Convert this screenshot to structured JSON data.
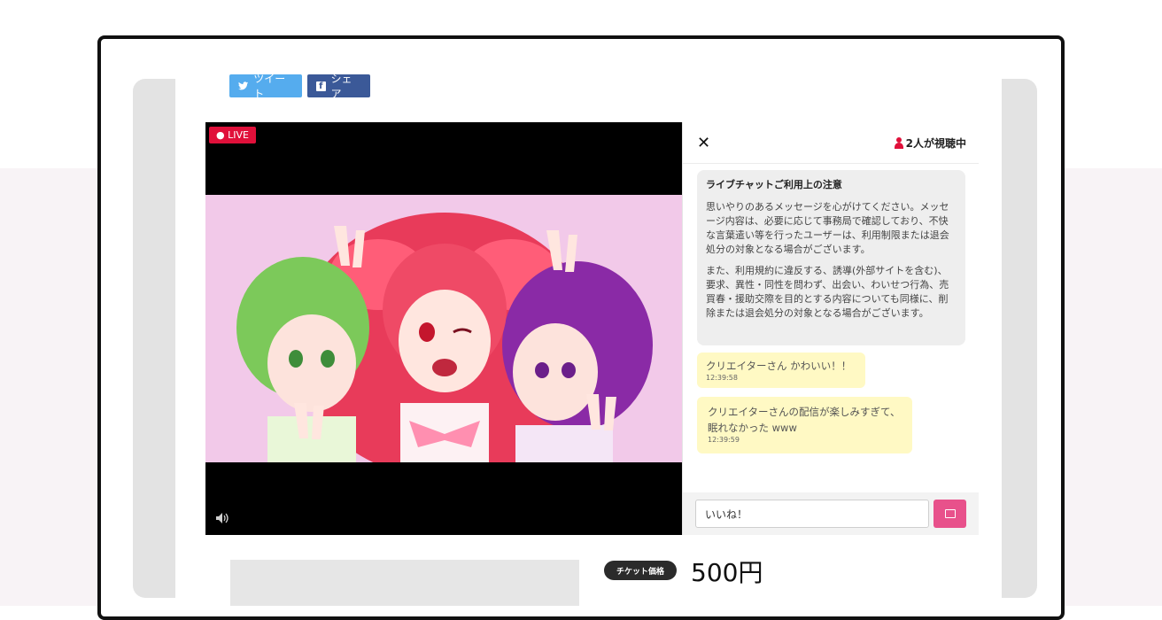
{
  "share": {
    "tweet_label": "ツイート",
    "share_label": "シェア"
  },
  "video": {
    "live_label": "● LIVE"
  },
  "chat": {
    "close_symbol": "✕",
    "viewers": "2人が視聴中",
    "notice": {
      "title": "ライブチャットご利用上の注意",
      "paragraph1": "思いやりのあるメッセージを心がけてください。メッセージ内容は、必要に応じて事務局で確認しており、不快な言葉遣い等を行ったユーザーは、利用制限または退会処分の対象となる場合がございます。",
      "paragraph2": "また、利用規約に違反する、誘導(外部サイトを含む)、要求、異性・同性を問わず、出会い、わいせつ行為、売買春・援助交際を目的とする内容についても同様に、削除または退会処分の対象となる場合がございます。"
    },
    "messages": [
      {
        "text": "クリエイターさん かわいい！！",
        "time": "12:39:58"
      },
      {
        "text": "クリエイターさんの配信が楽しみすぎて、眠れなかった www",
        "time": "12:39:59"
      }
    ],
    "input_value": "いいね！"
  },
  "ticket": {
    "badge": "チケット価格",
    "price": "500円"
  },
  "colors": {
    "live_red": "#e0103a",
    "send_pink": "#e8518b",
    "twitter_blue": "#55acee",
    "facebook_blue": "#3b5998",
    "message_yellow": "#fff9c4"
  }
}
